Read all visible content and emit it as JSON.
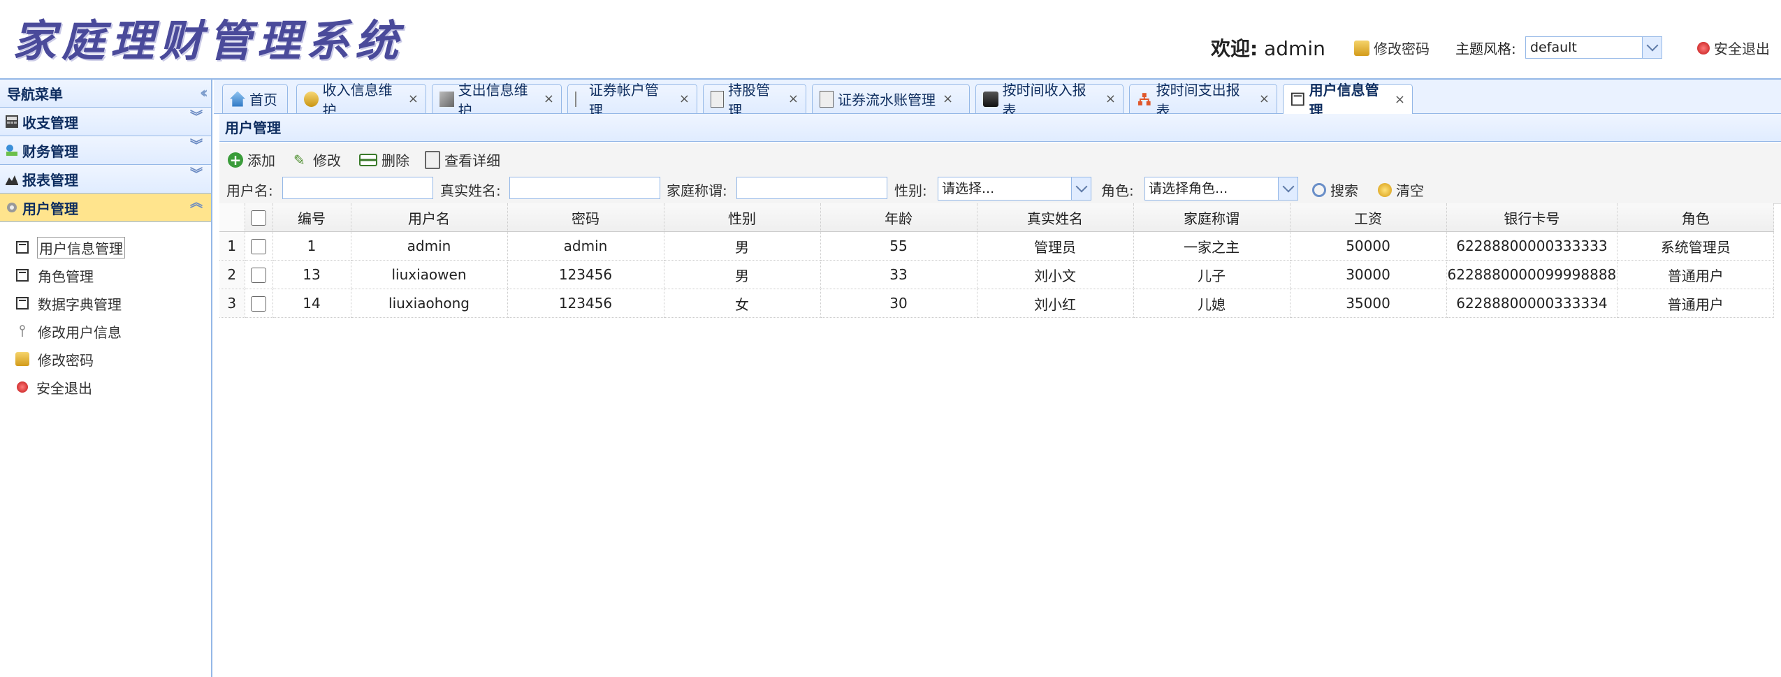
{
  "header": {
    "title": "家庭理财管理系统",
    "welcome_label": "欢迎:",
    "username": "admin",
    "change_password": "修改密码",
    "theme_label": "主题风格:",
    "theme_value": "default",
    "logout": "安全退出"
  },
  "sidebar": {
    "title": "导航菜单",
    "sections": [
      {
        "label": "收支管理"
      },
      {
        "label": "财务管理"
      },
      {
        "label": "报表管理"
      },
      {
        "label": "用户管理"
      }
    ],
    "items": [
      {
        "label": "用户信息管理"
      },
      {
        "label": "角色管理"
      },
      {
        "label": "数据字典管理"
      },
      {
        "label": "修改用户信息"
      },
      {
        "label": "修改密码"
      },
      {
        "label": "安全退出"
      }
    ]
  },
  "tabs": [
    {
      "label": "首页"
    },
    {
      "label": "收入信息维护"
    },
    {
      "label": "支出信息维护"
    },
    {
      "label": "证券帐户管理"
    },
    {
      "label": "持股管理"
    },
    {
      "label": "证券流水账管理"
    },
    {
      "label": "按时间收入报表"
    },
    {
      "label": "按时间支出报表"
    },
    {
      "label": "用户信息管理"
    }
  ],
  "panel": {
    "title": "用户管理",
    "toolbar": {
      "add": "添加",
      "edit": "修改",
      "delete": "删除",
      "detail": "查看详细"
    },
    "search": {
      "username_label": "用户名:",
      "realname_label": "真实姓名:",
      "family_label": "家庭称谓:",
      "gender_label": "性别:",
      "gender_placeholder": "请选择...",
      "role_label": "角色:",
      "role_placeholder": "请选择角色...",
      "search_btn": "搜索",
      "clear_btn": "清空"
    },
    "columns": [
      "编号",
      "用户名",
      "密码",
      "性别",
      "年龄",
      "真实姓名",
      "家庭称谓",
      "工资",
      "银行卡号",
      "角色"
    ],
    "rows": [
      {
        "rownum": "1",
        "cells": [
          "1",
          "admin",
          "admin",
          "男",
          "55",
          "管理员",
          "一家之主",
          "50000",
          "62288800000333333",
          "系统管理员"
        ]
      },
      {
        "rownum": "2",
        "cells": [
          "13",
          "liuxiaowen",
          "123456",
          "男",
          "33",
          "刘小文",
          "儿子",
          "30000",
          "6228880000099998888",
          "普通用户"
        ]
      },
      {
        "rownum": "3",
        "cells": [
          "14",
          "liuxiaohong",
          "123456",
          "女",
          "30",
          "刘小红",
          "儿媳",
          "35000",
          "62288800000333334",
          "普通用户"
        ]
      }
    ]
  }
}
